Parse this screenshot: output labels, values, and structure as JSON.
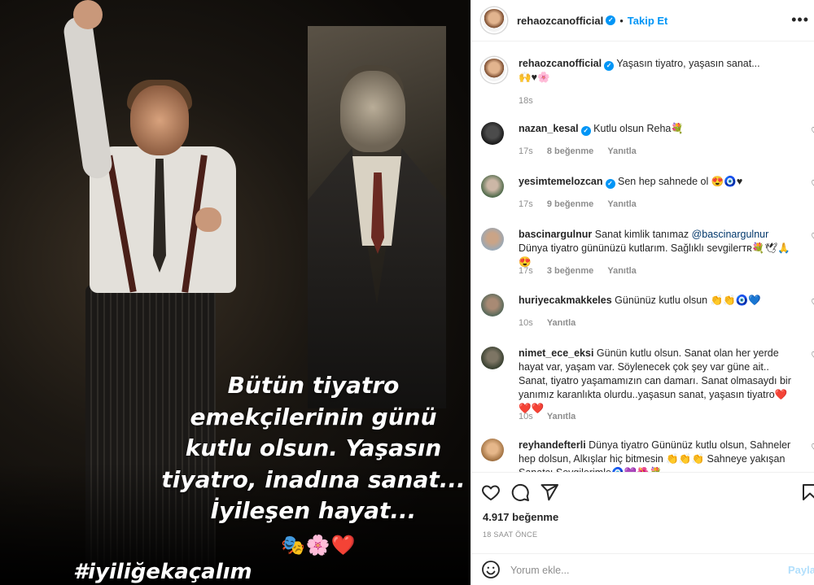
{
  "post": {
    "caption_lines": [
      "Bütün tiyatro",
      "emekçilerinin günü",
      "kutlu olsun. Yaşasın",
      "tiyatro, inadına sanat...",
      "İyileşen hayat..."
    ],
    "caption_emojis": "🎭🌸❤️",
    "hashtag": "#iyiliğekaçalım"
  },
  "header": {
    "username": "rehaozcanofficial",
    "verified_icon": "✓",
    "separator": "•",
    "follow_label": "Takip Et",
    "more_icon": "•••"
  },
  "owner_comment": {
    "username": "rehaozcanofficial",
    "text": "Yaşasın tiyatro, yaşasın sanat...",
    "emojis": "🙌♥🌸",
    "time": "18s"
  },
  "comments": [
    {
      "username": "nazan_kesal",
      "verified": true,
      "text": "Kutlu olsun Reha💐",
      "time": "17s",
      "likes": "8 beğenme",
      "reply": "Yanıtla"
    },
    {
      "username": "yesimtemelozcan",
      "verified": true,
      "text": "Sen hep sahnede ol 😍🧿♥",
      "time": "17s",
      "likes": "9 beğenme",
      "reply": "Yanıtla"
    },
    {
      "username": "bascinargulnur",
      "verified": false,
      "text_before": "Sanat kimlik tanımaz ",
      "mention": "@bascinargulnur",
      "text_after": " Dünya tiyatro gününüzü kutlarım. Sağlıklı sevgilerᴛʀ💐🕊🙏😍",
      "time": "17s",
      "likes": "3 beğenme",
      "reply": "Yanıtla"
    },
    {
      "username": "huriyecakmakkeles",
      "verified": false,
      "text": "Gününüz kutlu olsun 👏👏🧿💙",
      "time": "10s",
      "likes": "",
      "reply": "Yanıtla"
    },
    {
      "username": "nimet_ece_eksi",
      "verified": false,
      "text": "Günün kutlu olsun. Sanat olan her yerde hayat var, yaşam var. Söylenecek çok şey var güne ait.. Sanat, tiyatro yaşamamızın can damarı. Sanat olmasaydı bir yanımız karanlıkta olurdu..yaşasun sanat, yaşasın tiyatro❤️❤️❤️",
      "time": "10s",
      "likes": "",
      "reply": "Yanıtla"
    },
    {
      "username": "reyhandefterli",
      "verified": false,
      "text": "Dünya tiyatro Gününüz kutlu olsun, Sahneler hep dolsun, Alkışlar hiç bitmesin 👏👏👏 Sahneye yakışan Sanatçı Sevgilerimle🧿💜🌺💐",
      "time": "",
      "likes": "",
      "reply": ""
    }
  ],
  "footer": {
    "likes": "4.917 beğenme",
    "time": "18 SAAT ÖNCE",
    "comment_placeholder": "Yorum ekle...",
    "post_label": "Paylaş"
  },
  "colors": {
    "accent": "#0095f6",
    "text": "#262626",
    "muted": "#8e8e8e",
    "post_disabled": "#b2dffc"
  }
}
